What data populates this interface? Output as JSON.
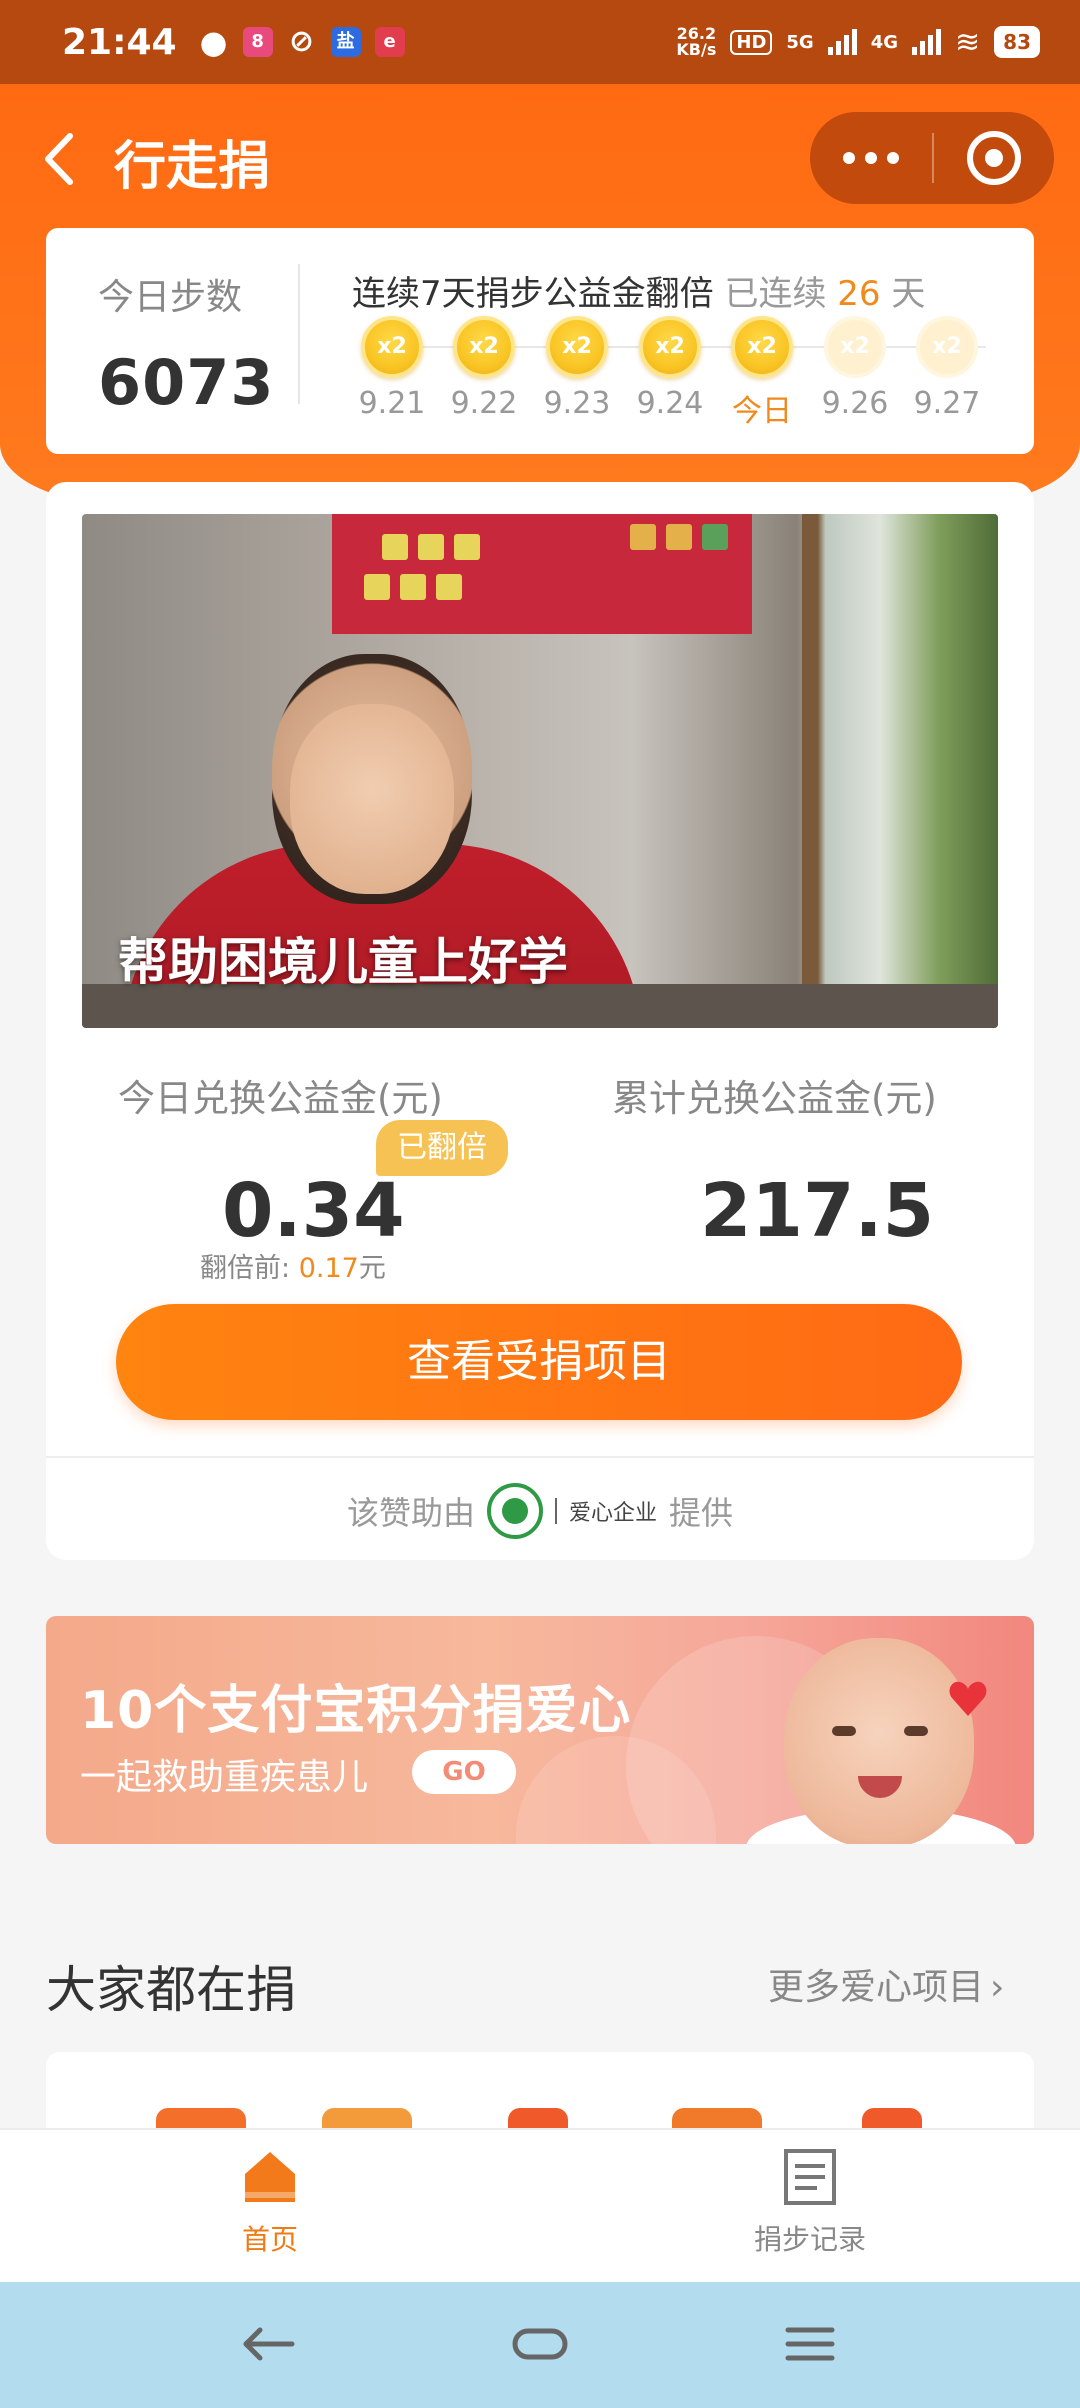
{
  "status_bar": {
    "time": "21:44",
    "net_speed_value": "26.2",
    "net_speed_unit": "KB/s",
    "hd_label": "HD",
    "net_5g": "5G",
    "net_4g": "4G",
    "battery": "83"
  },
  "nav": {
    "title": "行走捐"
  },
  "steps": {
    "label": "今日步数",
    "value": "6073",
    "streak_title": "连续7天捐步公益金翻倍",
    "streak_prefix": "已连续",
    "streak_days": "26",
    "streak_suffix": "天",
    "days": [
      {
        "coin": "x2",
        "label": "9.21",
        "state": "done"
      },
      {
        "coin": "x2",
        "label": "9.22",
        "state": "done"
      },
      {
        "coin": "x2",
        "label": "9.23",
        "state": "done"
      },
      {
        "coin": "x2",
        "label": "9.24",
        "state": "done"
      },
      {
        "coin": "x2",
        "label": "今日",
        "state": "today"
      },
      {
        "coin": "x2",
        "label": "9.26",
        "state": "future"
      },
      {
        "coin": "x2",
        "label": "9.27",
        "state": "future"
      }
    ]
  },
  "project": {
    "caption": "帮助困境儿童上好学",
    "today_label": "今日兑换公益金(元)",
    "total_label": "累计兑换公益金(元)",
    "doubled_badge": "已翻倍",
    "today_value": "0.34",
    "total_value": "217.5",
    "before_prefix": "翻倍前: ",
    "before_value": "0.17",
    "before_unit": "元",
    "view_button": "查看受捐项目",
    "sponsor_prefix": "该赞助由",
    "sponsor_company": "爱心企业",
    "sponsor_suffix": "提供"
  },
  "promo": {
    "title": "10个支付宝积分捐爱心",
    "subtitle": "一起救助重疾患儿",
    "go": "GO"
  },
  "section": {
    "title": "大家都在捐",
    "more": "更多爱心项目"
  },
  "tabs": {
    "home": "首页",
    "records": "捐步记录"
  },
  "colors": {
    "brand_orange": "#ff6a12",
    "accent_text": "#f08a1c",
    "status_bar": "#b5490f",
    "system_nav": "#b3dcef"
  }
}
